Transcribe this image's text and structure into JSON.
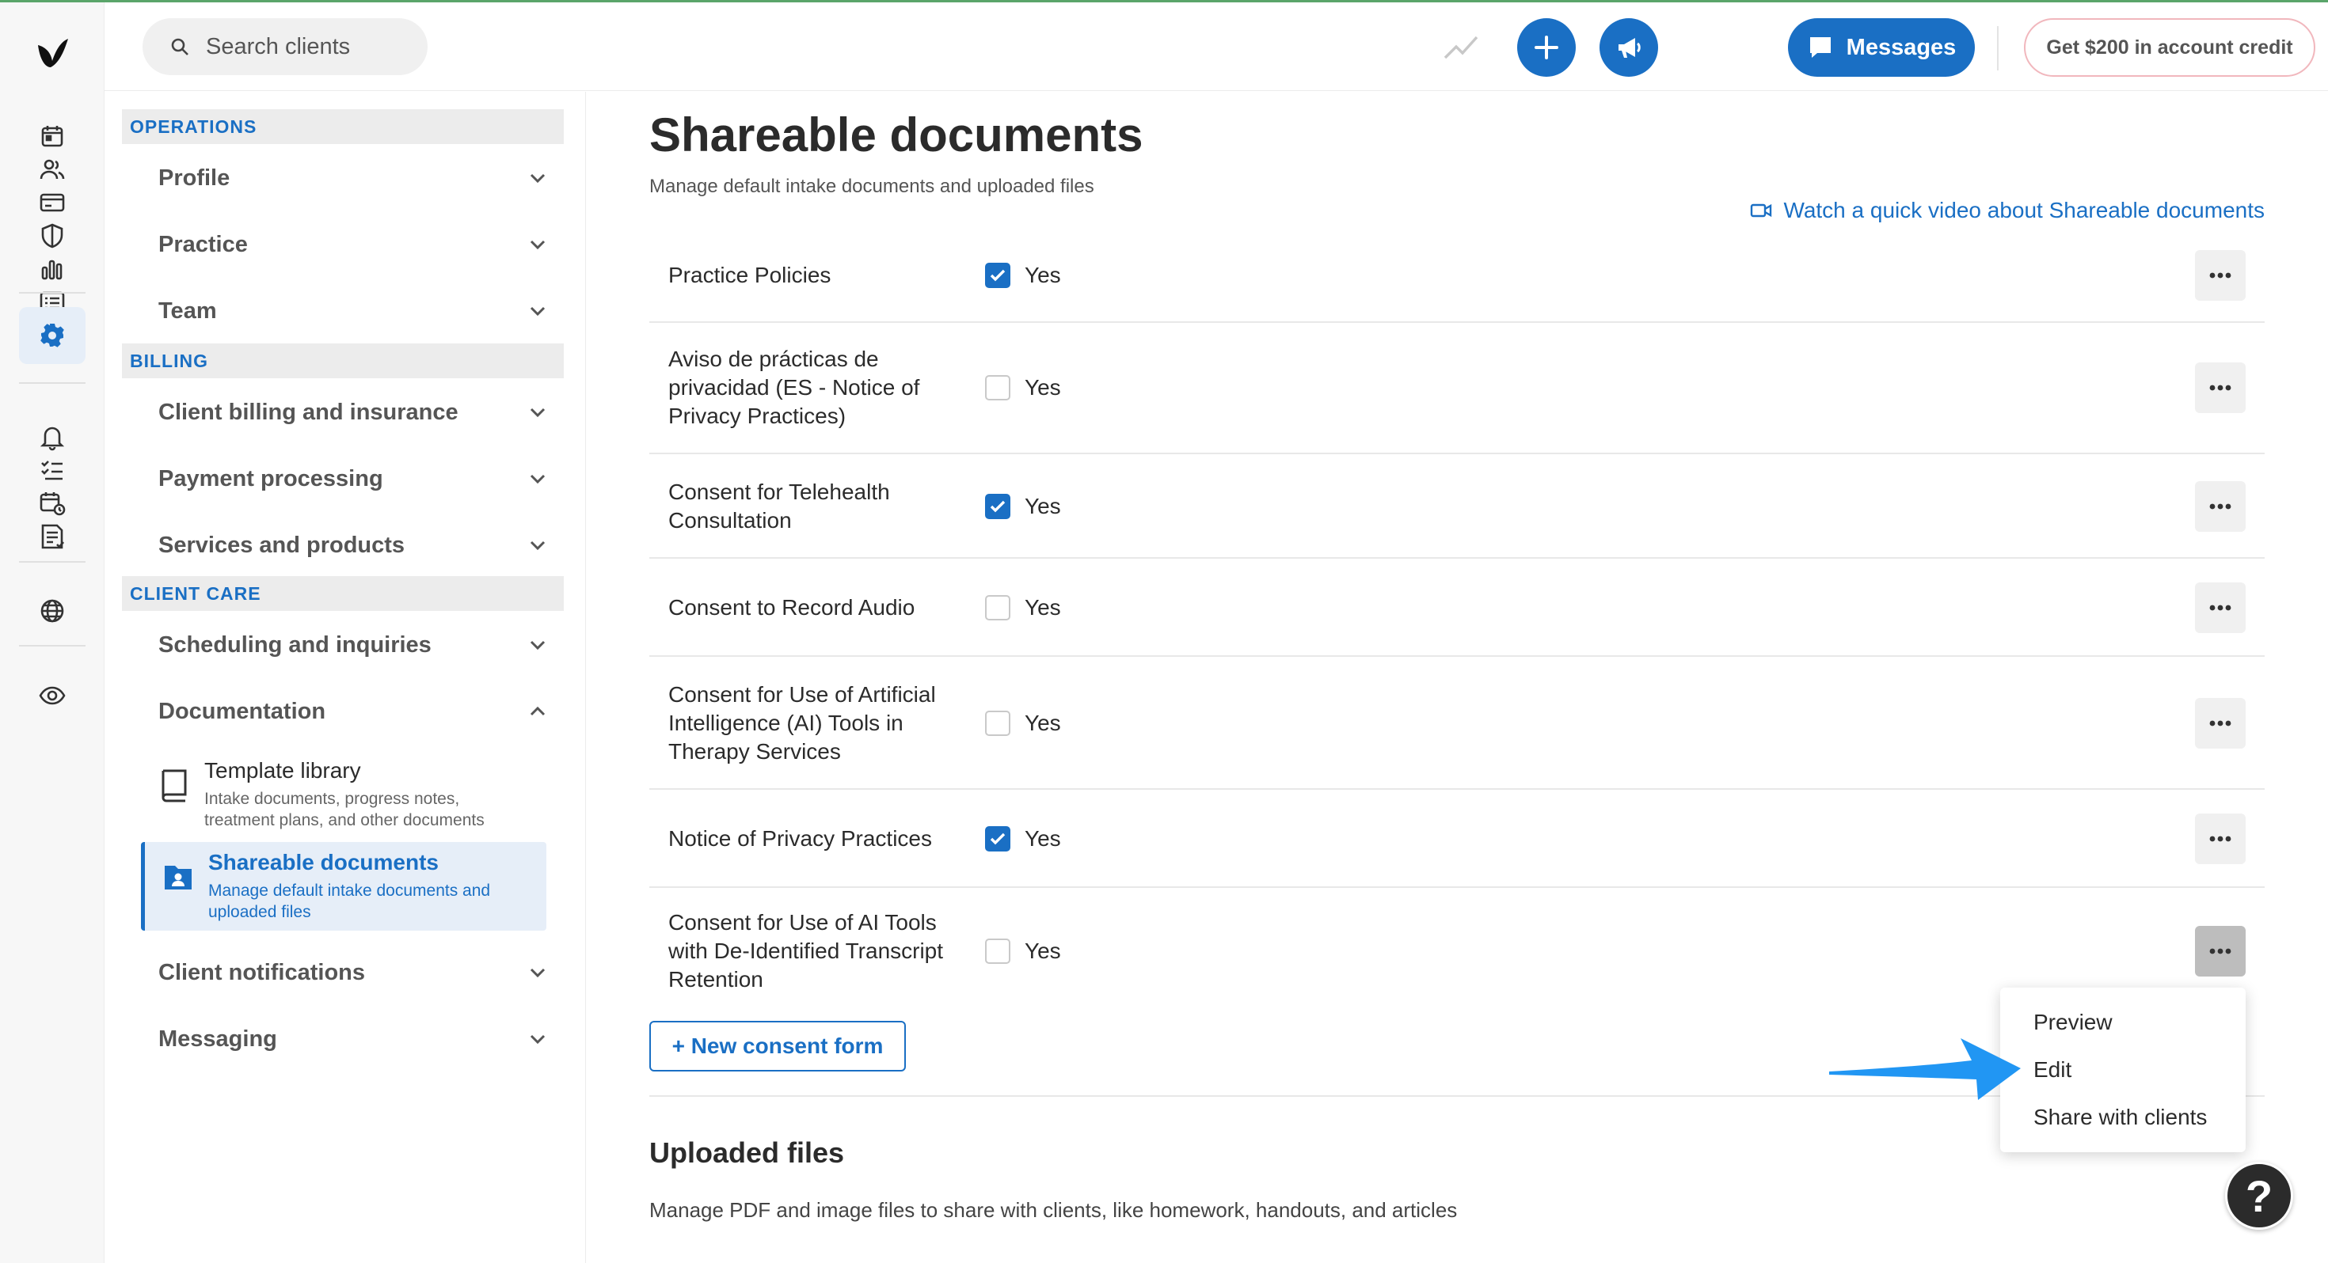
{
  "topbar": {
    "search_placeholder": "Search clients",
    "messages_label": "Messages",
    "credit_label": "Get $200 in account credit"
  },
  "rail": {
    "icons": [
      "calendar-icon",
      "clients-icon",
      "billing-icon",
      "insurance-icon",
      "analytics-icon",
      "list-icon",
      "settings-icon",
      "bell-icon",
      "tasks-icon",
      "schedule-icon",
      "notes-icon",
      "globe-icon",
      "eye-icon"
    ],
    "active": "settings-icon"
  },
  "nav": {
    "sections": {
      "operations": "OPERATIONS",
      "billing": "BILLING",
      "client_care": "CLIENT CARE"
    },
    "items": {
      "profile": "Profile",
      "practice": "Practice",
      "team": "Team",
      "client_billing": "Client billing and insurance",
      "payment_processing": "Payment processing",
      "services_products": "Services and products",
      "scheduling": "Scheduling and inquiries",
      "documentation": "Documentation",
      "client_notifications": "Client notifications",
      "messaging": "Messaging"
    },
    "sub": {
      "template_title": "Template library",
      "template_desc": "Intake documents, progress notes, treatment plans, and other documents",
      "shareable_title": "Shareable documents",
      "shareable_desc": "Manage default intake documents and uploaded files"
    }
  },
  "main": {
    "title": "Shareable documents",
    "subtitle": "Manage default intake documents and uploaded files",
    "video_link": "Watch a quick video about Shareable documents",
    "yes_label": "Yes",
    "documents": [
      {
        "name": "Practice Policies",
        "checked": true
      },
      {
        "name": "Aviso de prácticas de privacidad (ES - Notice of Privacy Practices)",
        "checked": false
      },
      {
        "name": "Consent for Telehealth Consultation",
        "checked": true
      },
      {
        "name": "Consent to Record Audio",
        "checked": false
      },
      {
        "name": "Consent for Use of Artificial Intelligence (AI) Tools in Therapy Services",
        "checked": false
      },
      {
        "name": "Notice of Privacy Practices",
        "checked": true
      },
      {
        "name": "Consent for Use of AI Tools with De-Identified Transcript Retention",
        "checked": false
      }
    ],
    "new_consent_label": "+ New consent form",
    "uploaded_title": "Uploaded files",
    "uploaded_desc": "Manage PDF and image files to share with clients, like homework, handouts, and articles"
  },
  "menu": {
    "items": [
      "Preview",
      "Edit",
      "Share with clients"
    ]
  },
  "help_label": "?",
  "colors": {
    "accent": "#1a6fc4",
    "active_bg": "#e6eef8",
    "arrow": "#2196f3"
  }
}
